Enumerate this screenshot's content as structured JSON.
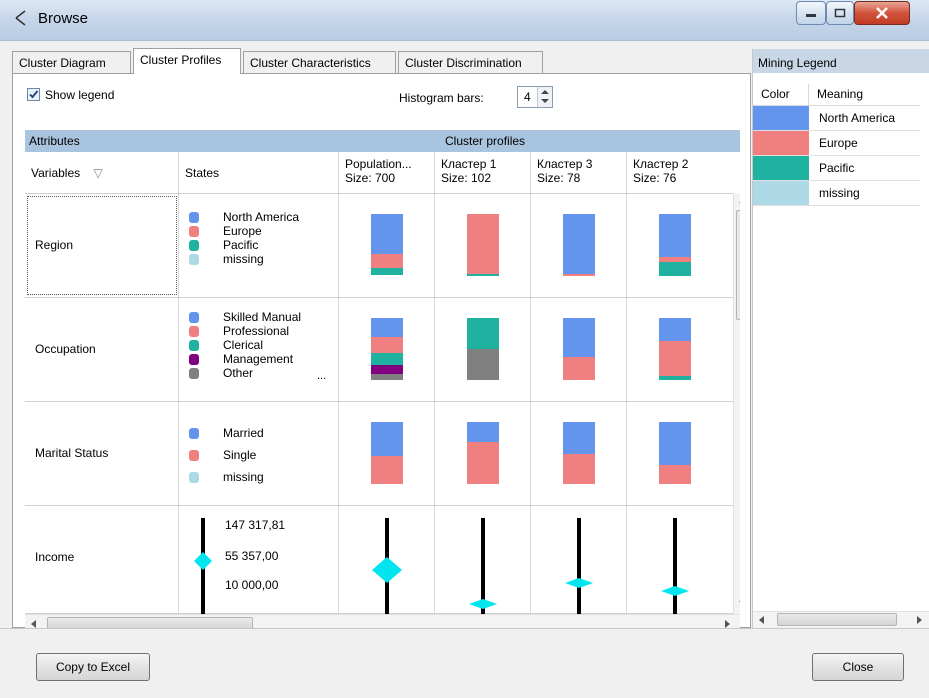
{
  "window": {
    "title": "Browse",
    "icon": "browse-cursor-icon"
  },
  "tabs": [
    {
      "label": "Cluster Diagram",
      "active": false
    },
    {
      "label": "Cluster Profiles",
      "active": true
    },
    {
      "label": "Cluster Characteristics",
      "active": false
    },
    {
      "label": "Cluster Discrimination",
      "active": false
    }
  ],
  "options": {
    "show_legend_label": "Show legend",
    "show_legend_checked": true,
    "histogram_label": "Histogram bars:",
    "histogram_value": "4"
  },
  "grid": {
    "group_attributes": "Attributes",
    "group_profiles": "Cluster profiles",
    "col_variables": "Variables",
    "col_states": "States",
    "profile_columns": [
      {
        "line1": "Population...",
        "line2": "Size: 700"
      },
      {
        "line1": "Кластер 1",
        "line2": "Size: 102"
      },
      {
        "line1": "Кластер 3",
        "line2": "Size: 78"
      },
      {
        "line1": "Кластер 2",
        "line2": "Size: 76"
      }
    ],
    "rows": [
      {
        "variable": "Region",
        "states": [
          {
            "label": "North America",
            "color": "#6495ed"
          },
          {
            "label": "Europe",
            "color": "#f07f7f"
          },
          {
            "label": "Pacific",
            "color": "#20b2a0"
          },
          {
            "label": "missing",
            "color": "#add8e6"
          }
        ],
        "profiles": [
          [
            0.65,
            0.23,
            0.12,
            0.0
          ],
          [
            0.0,
            0.96,
            0.04,
            0.0
          ],
          [
            0.97,
            0.03,
            0.0,
            0.0
          ],
          [
            0.7,
            0.08,
            0.22,
            0.0
          ]
        ]
      },
      {
        "variable": "Occupation",
        "states": [
          {
            "label": "Skilled Manual",
            "color": "#6495ed"
          },
          {
            "label": "Professional",
            "color": "#f07f7f"
          },
          {
            "label": "Clerical",
            "color": "#20b2a0"
          },
          {
            "label": "Management",
            "color": "#800080"
          },
          {
            "label": "Other",
            "color": "#808080"
          }
        ],
        "more": "...",
        "profiles": [
          [
            0.3,
            0.25,
            0.2,
            0.15,
            0.1
          ],
          [
            0.0,
            0.0,
            0.5,
            0.0,
            0.5
          ],
          [
            0.63,
            0.37,
            0.0,
            0.0,
            0.0
          ],
          [
            0.37,
            0.57,
            0.06,
            0.0,
            0.0
          ]
        ]
      },
      {
        "variable": "Marital Status",
        "states": [
          {
            "label": "Married",
            "color": "#6495ed"
          },
          {
            "label": "Single",
            "color": "#f07f7f"
          },
          {
            "label": "missing",
            "color": "#add8e6"
          }
        ],
        "profiles": [
          [
            0.55,
            0.45,
            0.0
          ],
          [
            0.33,
            0.67,
            0.0
          ],
          [
            0.52,
            0.48,
            0.0
          ],
          [
            0.7,
            0.3,
            0.0
          ]
        ]
      },
      {
        "variable": "Income",
        "states_numeric": [
          "147 317,81",
          "55 357,00",
          "10 000,00"
        ],
        "marker_color": "#00e5ee",
        "profiles_marker": [
          0.55,
          0.95,
          0.7,
          0.8
        ]
      }
    ]
  },
  "legend": {
    "title": "Mining Legend",
    "col_color": "Color",
    "col_meaning": "Meaning",
    "items": [
      {
        "meaning": "North America",
        "color": "#6495ed"
      },
      {
        "meaning": "Europe",
        "color": "#f07f7f"
      },
      {
        "meaning": "Pacific",
        "color": "#20b2a0"
      },
      {
        "meaning": "missing",
        "color": "#add8e6"
      }
    ]
  },
  "footer": {
    "copy_label": "Copy to Excel",
    "close_label": "Close"
  }
}
